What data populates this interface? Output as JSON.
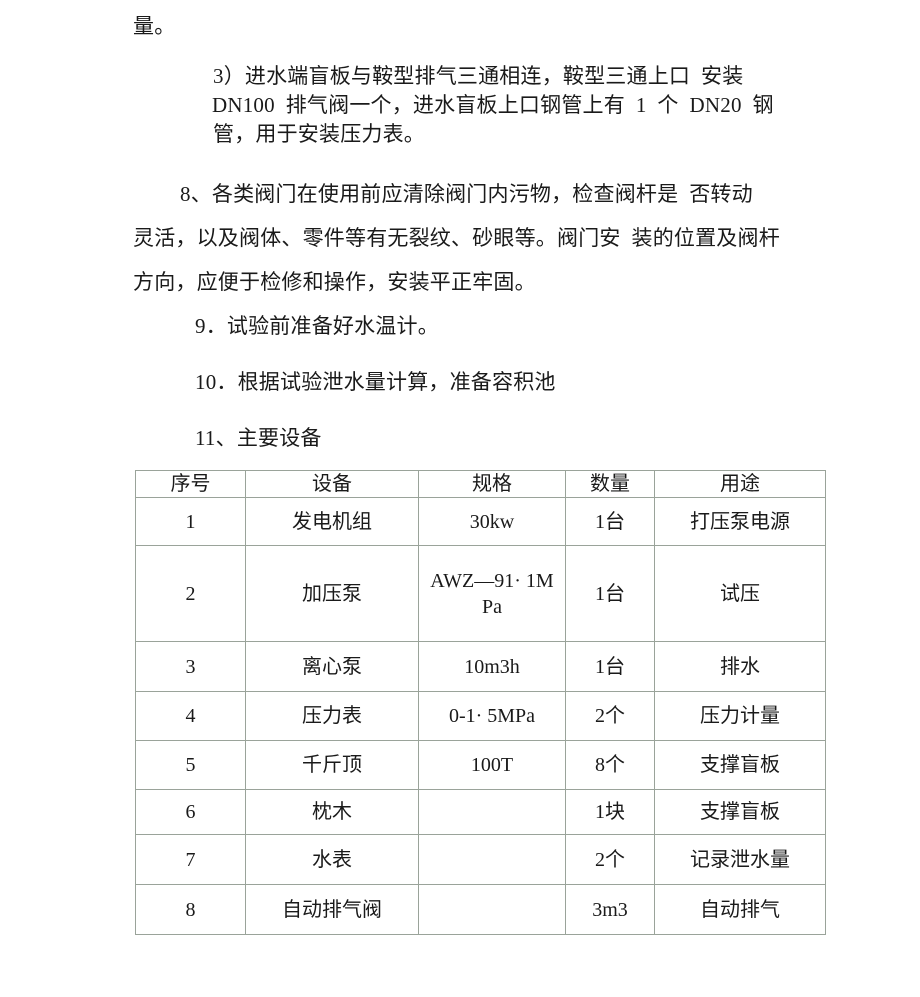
{
  "document": {
    "paragraphs": [
      {
        "id": "continuation",
        "lines": [
          "量。"
        ]
      },
      {
        "id": "item-3",
        "lines": [
          "3）进水端盲板与鞍型排气三通相连，鞍型三通上口  安装",
          "DN100  排气阀一个，进水盲板上口钢管上有  1  个  DN20  钢",
          "管，用于安装压力表。"
        ]
      },
      {
        "id": "item-8",
        "lines": [
          "8、各类阀门在使用前应清除阀门内污物，检查阀杆是  否转动",
          "灵活，以及阀体、零件等有无裂纹、砂眼等。阀门安  装的位置及阀杆",
          "方向，应便于检修和操作，安装平正牢固。"
        ]
      },
      {
        "id": "item-9",
        "lines": [
          "9．试验前准备好水温计。"
        ]
      },
      {
        "id": "item-10",
        "lines": [
          "10．根据试验泄水量计算，准备容积池"
        ]
      },
      {
        "id": "item-11",
        "lines": [
          "11、主要设备"
        ]
      }
    ],
    "table": {
      "headers": [
        "序号",
        "设备",
        "规格",
        "数量",
        "用途"
      ],
      "rows": [
        {
          "no": "1",
          "device": "发电机组",
          "spec": "30kw",
          "spec2": "",
          "qty": "1台",
          "use": "打压泵电源"
        },
        {
          "no": "2",
          "device": "加压泵",
          "spec": "AWZ—91· 1M",
          "spec2": "Pa",
          "qty": "1台",
          "use": "试压"
        },
        {
          "no": "3",
          "device": "离心泵",
          "spec": "10m3h",
          "spec2": "",
          "qty": "1台",
          "use": "排水"
        },
        {
          "no": "4",
          "device": "压力表",
          "spec": "0-1· 5MPa",
          "spec2": "",
          "qty": "2个",
          "use": "压力计量"
        },
        {
          "no": "5",
          "device": "千斤顶",
          "spec": "100T",
          "spec2": "",
          "qty": "8个",
          "use": "支撑盲板"
        },
        {
          "no": "6",
          "device": "枕木",
          "spec": "",
          "spec2": "",
          "qty": "1块",
          "use": "支撑盲板"
        },
        {
          "no": "7",
          "device": "水表",
          "spec": "",
          "spec2": "",
          "qty": "2个",
          "use": "记录泄水量"
        },
        {
          "no": "8",
          "device": "自动排气阀",
          "spec": "",
          "spec2": "",
          "qty": "3m3",
          "use": "自动排气"
        }
      ]
    }
  },
  "colors": {
    "text": "#1a1a1a",
    "table_border": "#9aa39a",
    "page_background": "#ffffff"
  }
}
